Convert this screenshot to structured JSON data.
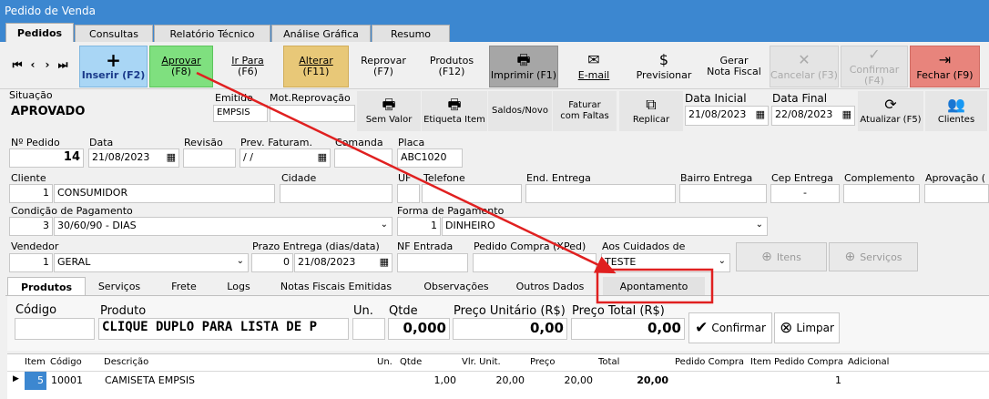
{
  "window": {
    "title": "Pedido de Venda"
  },
  "tabs": [
    "Pedidos",
    "Consultas",
    "Relatório Técnico",
    "Análise Gráfica",
    "Resumo"
  ],
  "toolbar": {
    "nav": [
      "⏮",
      "‹",
      "›",
      "⏭"
    ],
    "inserir": {
      "label": "Inserir (F2)",
      "icon": "+"
    },
    "aprovar": {
      "line1": "Aprovar",
      "line2": "(F8)"
    },
    "irpara": {
      "line1": "Ir Para",
      "line2": "(F6)"
    },
    "alterar": {
      "line1": "Alterar",
      "line2": "(F11)"
    },
    "reprovar": {
      "line1": "Reprovar",
      "line2": "(F7)"
    },
    "produtos": {
      "line1": "Produtos",
      "line2": "(F12)"
    },
    "imprimir": {
      "label": "Imprimir (F1)",
      "icon": "🖶"
    },
    "email": {
      "label": "E-mail",
      "icon": "✉"
    },
    "previsionar": {
      "label": "Previsionar",
      "icon": "$"
    },
    "gerar": {
      "line1": "Gerar",
      "line2": "Nota Fiscal"
    },
    "cancelar": {
      "label": "Cancelar (F3)",
      "icon": "✕"
    },
    "confirmar": {
      "label": "Confirmar (F4)",
      "icon": "✓"
    },
    "fechar": {
      "label": "Fechar (F9)",
      "icon": "⇥"
    }
  },
  "row2": {
    "situacao_label": "Situação",
    "situacao_value": "APROVADO",
    "emitido_label": "Emitido",
    "emitido_value": "EMPSIS",
    "motrep_label": "Mot.Reprovação",
    "motrep_value": "",
    "semvalor": "Sem Valor",
    "etiqueta": "Etiqueta Item",
    "saldos": "Saldos/Novo",
    "faturar_line1": "Faturar",
    "faturar_line2": "com Faltas",
    "replicar": "Replicar",
    "datainicial_label": "Data Inicial",
    "datainicial_value": "21/08/2023",
    "datafinal_label": "Data Final",
    "datafinal_value": "22/08/2023",
    "atualizar": "Atualizar (F5)",
    "clientes": "Clientes"
  },
  "form": {
    "npedido_label": "Nº Pedido",
    "npedido_value": "14",
    "data_label": "Data",
    "data_value": "21/08/2023",
    "revisao_label": "Revisão",
    "revisao_value": "",
    "prevfat_label": "Prev. Faturam.",
    "prevfat_value": "/ /",
    "comanda_label": "Comanda",
    "comanda_value": "",
    "placa_label": "Placa",
    "placa_value": "ABC1020",
    "cliente_label": "Cliente",
    "cliente_code": "1",
    "cliente_name": "CONSUMIDOR",
    "cidade_label": "Cidade",
    "cidade_value": "",
    "uf_label": "UF",
    "uf_value": "",
    "telefone_label": "Telefone",
    "telefone_value": "",
    "endentrega_label": "End. Entrega",
    "endentrega_value": "",
    "bairro_label": "Bairro Entrega",
    "bairro_value": "",
    "cep_label": "Cep Entrega",
    "cep_value": "-",
    "complemento_label": "Complemento",
    "complemento_value": "",
    "aprovacao_label": "Aprovação (",
    "condpag_label": "Condição de Pagamento",
    "condpag_code": "3",
    "condpag_name": "30/60/90 - DIAS",
    "formapag_label": "Forma de Pagamento",
    "formapag_code": "1",
    "formapag_name": "DINHEIRO",
    "vendedor_label": "Vendedor",
    "vendedor_code": "1",
    "vendedor_name": "GERAL",
    "prazo_label": "Prazo Entrega (dias/data)",
    "prazo_days": "0",
    "prazo_date": "21/08/2023",
    "nfentrada_label": "NF Entrada",
    "nfentrada_value": "",
    "pedcompra_label": "Pedido Compra (XPed)",
    "pedcompra_value": "",
    "cuidados_label": "Aos Cuidados de",
    "cuidados_value": "TESTE",
    "itens_btn": "Itens",
    "servicos_btn": "Serviços"
  },
  "subtabs": [
    "Produtos",
    "Serviços",
    "Frete",
    "Logs",
    "Notas Fiscais Emitidas",
    "Observações",
    "Outros Dados",
    "Apontamento"
  ],
  "entry": {
    "codigo_label": "Código",
    "produto_label": "Produto",
    "produto_value": "CLIQUE DUPLO PARA LISTA DE P",
    "un_label": "Un.",
    "qtde_label": "Qtde",
    "qtde_value": "0,000",
    "precounit_label": "Preço Unitário (R$)",
    "precounit_value": "0,00",
    "precototal_label": "Preço Total (R$)",
    "precototal_value": "0,00",
    "confirmar_btn": "Confirmar",
    "limpar_btn": "Limpar"
  },
  "grid": {
    "headers": [
      "Item",
      "Código",
      "Descrição",
      "Un.",
      "Qtde",
      "Vlr. Unit.",
      "Preço",
      "Total",
      "Pedido Compra",
      "Item Pedido Compra",
      "Adicional"
    ],
    "row": {
      "item": "5",
      "codigo": "10001",
      "descricao": "CAMISETA EMPSIS",
      "un": "",
      "qtde": "1,00",
      "vlrunit": "20,00",
      "preco": "20,00",
      "total": "20,00",
      "pedcompra": "",
      "itempedcompra": "1",
      "adicional": ""
    }
  },
  "colors": {
    "titlebar": "#3c87d0",
    "inserir": "#a9d6f5",
    "aprovar": "#7fe07f",
    "alterar": "#e8c878",
    "imprimir": "#a6a6a6",
    "fechar": "#e8847c",
    "annotation": "#e02020"
  }
}
